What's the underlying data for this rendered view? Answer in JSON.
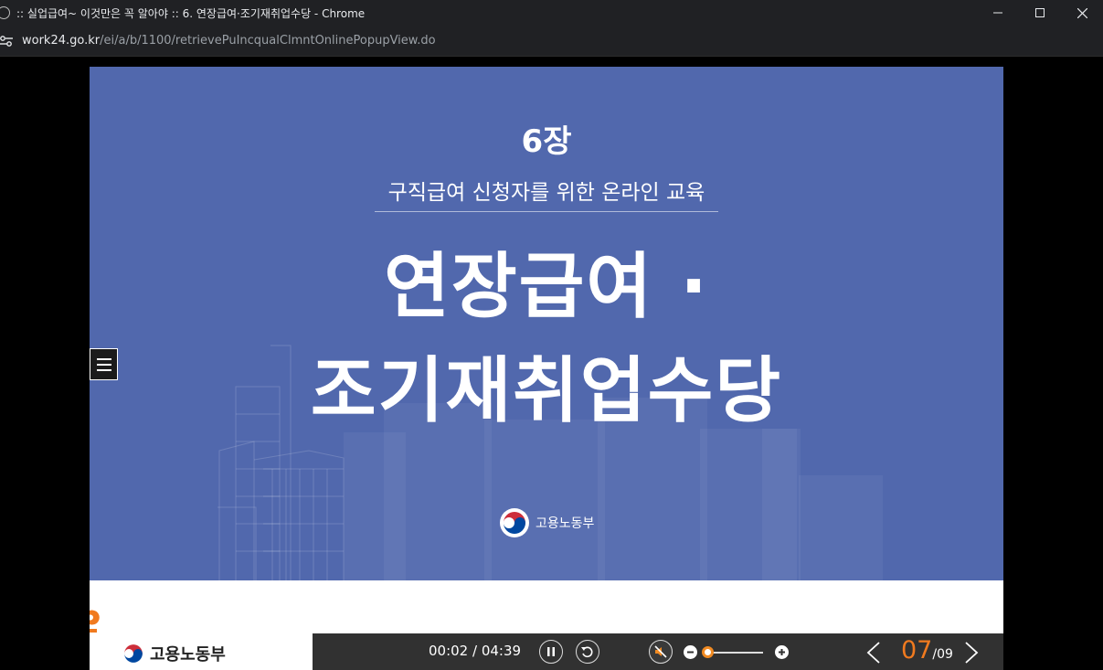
{
  "window": {
    "title": ":: 실업급여~ 이것만은 꼭 알아야 :: 6. 연장급여·조기재취업수당 - Chrome"
  },
  "urlbar": {
    "domain": "work24.go.kr",
    "path": "/ei/a/b/1100/retrievePuIncqualClmntOnlinePopupView.do"
  },
  "slide": {
    "chapter": "6장",
    "subtitle": "구직급여 신청자를 위한 온라인 교육",
    "title_line1": "연장급여 ·",
    "title_line2": "조기재취업수당",
    "logo_text": "고용노동부"
  },
  "footer": {
    "logo_text": "고용노동부"
  },
  "player": {
    "time": "00:02 / 04:39",
    "current_page": "07",
    "total_pages": "/09",
    "volume_level": 0.0
  },
  "colors": {
    "slide_bg": "#5168ad",
    "accent": "#f07a1f",
    "control_bar": "#313131"
  }
}
